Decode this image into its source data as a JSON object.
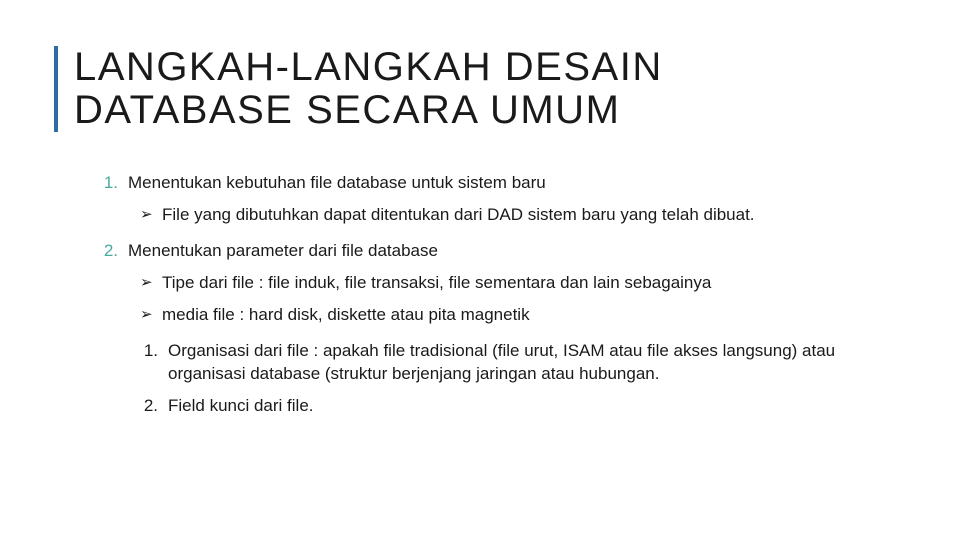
{
  "title": {
    "line1": "LANGKAH-LANGKAH DESAIN",
    "line2": "DATABASE SECARA UMUM"
  },
  "items": {
    "n1": {
      "marker": "1.",
      "text": "Menentukan kebutuhan file database untuk sistem baru"
    },
    "n1a": {
      "marker": "➢",
      "text": "File yang dibutuhkan dapat ditentukan dari DAD sistem baru yang telah dibuat."
    },
    "n2": {
      "marker": "2.",
      "text": "Menentukan parameter dari file database"
    },
    "n2a": {
      "marker": "➢",
      "text": "Tipe dari file : file induk, file transaksi, file sementara dan lain sebagainya"
    },
    "n2b": {
      "marker": "➢",
      "text": "media file : hard disk, diskette atau pita magnetik"
    },
    "n2c": {
      "marker": "1.",
      "text": "Organisasi dari file : apakah file tradisional (file urut, ISAM atau file akses langsung) atau organisasi database (struktur berjenjang jaringan atau hubungan."
    },
    "n2d": {
      "marker": "2.",
      "text": "Field kunci dari file."
    }
  }
}
